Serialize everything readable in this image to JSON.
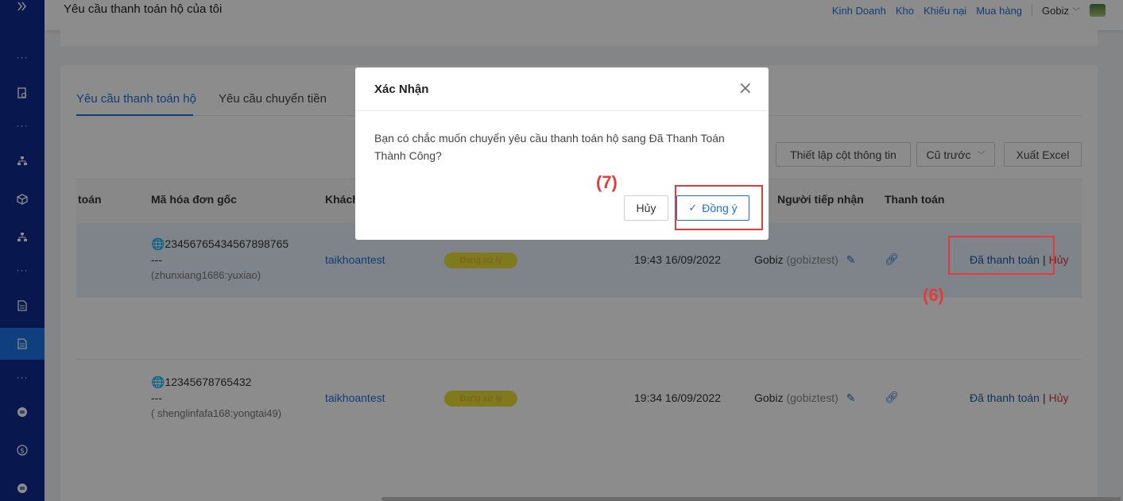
{
  "header": {
    "title": "Yêu cầu thanh toán hộ của tôi",
    "links": [
      "Kinh Doanh",
      "Kho",
      "Khiếu nại",
      "Mua hàng"
    ],
    "user": "Gobiz"
  },
  "tabs": [
    {
      "label": "Yêu cầu thanh toán hộ"
    },
    {
      "label": "Yêu cầu chuyển tiền"
    }
  ],
  "toolbar": {
    "columns_label": "Thiết lập cột thông tin",
    "sort_label": "Cũ trước",
    "export_label": "Xuất Excel"
  },
  "table": {
    "headers": {
      "col_partial": "toán",
      "invoice": "Mã hóa đơn gốc",
      "customer": "Khách",
      "receiver": "Người tiếp nhận",
      "payment": "Thanh toán"
    },
    "rows": [
      {
        "invoice": "🌐23456765434567898765",
        "dash": "---",
        "account": "(zhunxiang1686:yuxiao)",
        "customer": "taikhoantest",
        "status": "Đang xử lý",
        "time": "19:43 16/09/2022",
        "receiver": "Gobiz",
        "receiver_id": "(gobiztest)",
        "paid": "Đã thanh toán",
        "cancel": "Hủy"
      },
      {
        "invoice": "🌐12345678765432",
        "dash": "---",
        "account": "( shenglinfafa168:yongtai49)",
        "customer": "taikhoantest",
        "status": "Đang xử lý",
        "time": "19:34 16/09/2022",
        "receiver": "Gobiz",
        "receiver_id": "(gobiztest)",
        "paid": "Đã thanh toán",
        "cancel": "Hủy"
      }
    ]
  },
  "modal": {
    "title": "Xác Nhận",
    "body": "Bạn có chắc muốn chuyển yêu cầu thanh toán hộ sang Đã Thanh Toán Thành Công?",
    "cancel_label": "Hủy",
    "ok_label": "Đồng ý"
  },
  "annotations": {
    "step7": "(7)",
    "step6": "(6)"
  },
  "colors": {
    "sidebar": "#0f2c8f",
    "accent": "#1e6fd9",
    "annotation": "#e23b3b"
  }
}
